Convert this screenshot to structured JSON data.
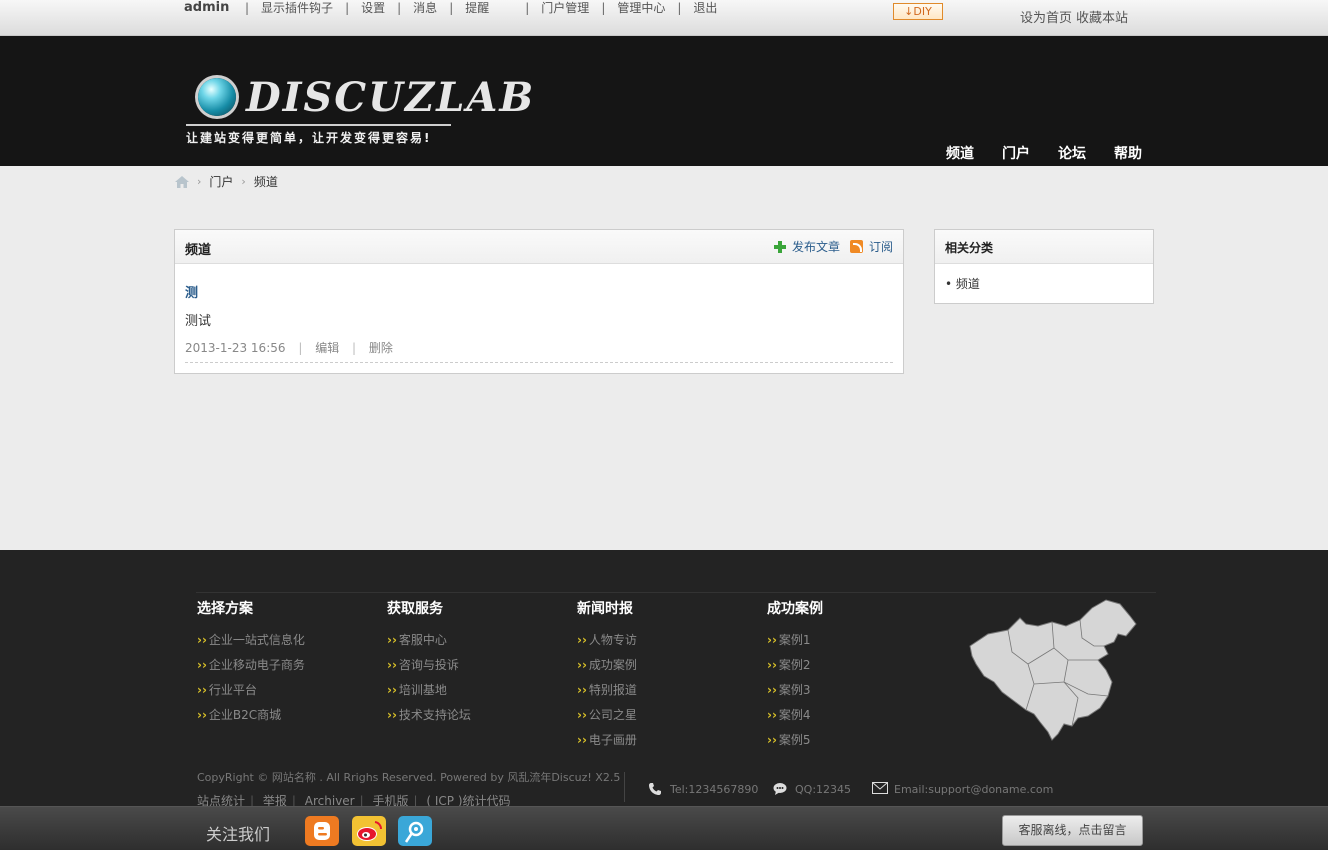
{
  "topbar": {
    "username": "admin",
    "links": [
      "显示插件钩子",
      "设置",
      "消息",
      "提醒",
      "门户管理",
      "管理中心",
      "退出"
    ],
    "diy_label": "DIY",
    "set_home": "设为首页",
    "bookmark": "收藏本站"
  },
  "header": {
    "logo_name": "DISCUZLAB",
    "logo_slogan": "让建站变得更简单，让开发变得更容易!",
    "nav": [
      "频道",
      "门户",
      "论坛",
      "帮助"
    ]
  },
  "breadcrumb": [
    "门户",
    "频道"
  ],
  "main": {
    "title": "频道",
    "publish_label": "发布文章",
    "subscribe_label": "订阅",
    "article": {
      "title": "测",
      "summary": "测试",
      "date": "2013-1-23 16:56",
      "edit": "编辑",
      "delete": "删除"
    }
  },
  "sidebar": {
    "title": "相关分类",
    "items": [
      "频道"
    ]
  },
  "footer": {
    "columns": [
      {
        "title": "选择方案",
        "items": [
          "企业一站式信息化",
          "企业移动电子商务",
          "行业平台",
          "企业B2C商城"
        ]
      },
      {
        "title": "获取服务",
        "items": [
          "客服中心",
          "咨询与投诉",
          "培训基地",
          "技术支持论坛"
        ]
      },
      {
        "title": "新闻时报",
        "items": [
          "人物专访",
          "成功案例",
          "特别报道",
          "公司之星",
          "电子画册"
        ]
      },
      {
        "title": "成功案例",
        "items": [
          "案例1",
          "案例2",
          "案例3",
          "案例4",
          "案例5"
        ]
      }
    ],
    "copyright": "CopyRight © 网站名称  . All Rrighs Reserved. Powered by 风乱流年Discuz! X2.5",
    "links": [
      "站点统计",
      "举报",
      "Archiver",
      "手机版",
      "( ICP )统计代码"
    ],
    "tel": "Tel:1234567890",
    "qq": "QQ:12345",
    "email": "Email:support@doname.com"
  },
  "bottom": {
    "follow": "关注我们",
    "service": "客服离线，点击留言"
  },
  "icons": {
    "blogger": "blogger-icon",
    "weibo": "weibo-icon",
    "qq_weibo": "tencent-weibo-icon"
  },
  "colors": {
    "header_bg": "#151515",
    "link_blue": "#2b5d8c",
    "footer_bg": "#232323",
    "bullet_yellow": "#d8c028"
  }
}
